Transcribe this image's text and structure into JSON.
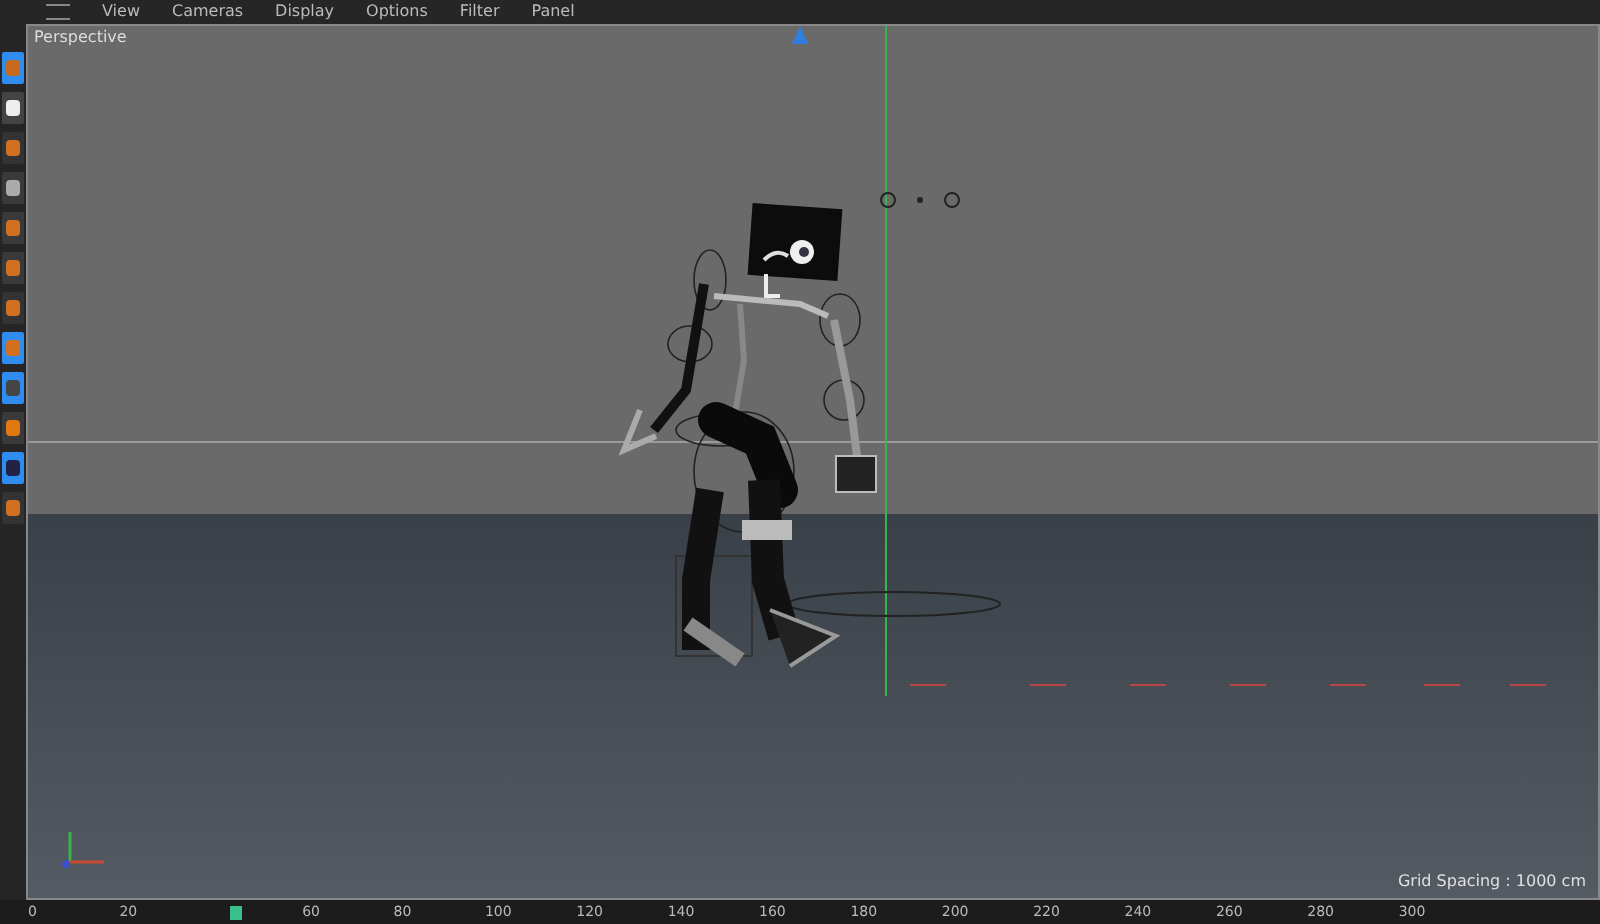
{
  "menu": [
    "View",
    "Cameras",
    "Display",
    "Options",
    "Filter",
    "Panel"
  ],
  "viewport": {
    "label": "Perspective",
    "grid_spacing": "Grid Spacing : 1000 cm"
  },
  "timeline": [
    {
      "kind": "tick",
      "label": "0"
    },
    {
      "kind": "tick",
      "label": "20"
    },
    {
      "kind": "current"
    },
    {
      "kind": "tick",
      "label": "60"
    },
    {
      "kind": "tick",
      "label": "80"
    },
    {
      "kind": "tick",
      "label": "100"
    },
    {
      "kind": "tick",
      "label": "120"
    },
    {
      "kind": "tick",
      "label": "140"
    },
    {
      "kind": "tick",
      "label": "160"
    },
    {
      "kind": "tick",
      "label": "180"
    },
    {
      "kind": "tick",
      "label": "200"
    },
    {
      "kind": "tick",
      "label": "220"
    },
    {
      "kind": "tick",
      "label": "240"
    },
    {
      "kind": "tick",
      "label": "260"
    },
    {
      "kind": "tick",
      "label": "280"
    },
    {
      "kind": "tick",
      "label": "300"
    }
  ]
}
